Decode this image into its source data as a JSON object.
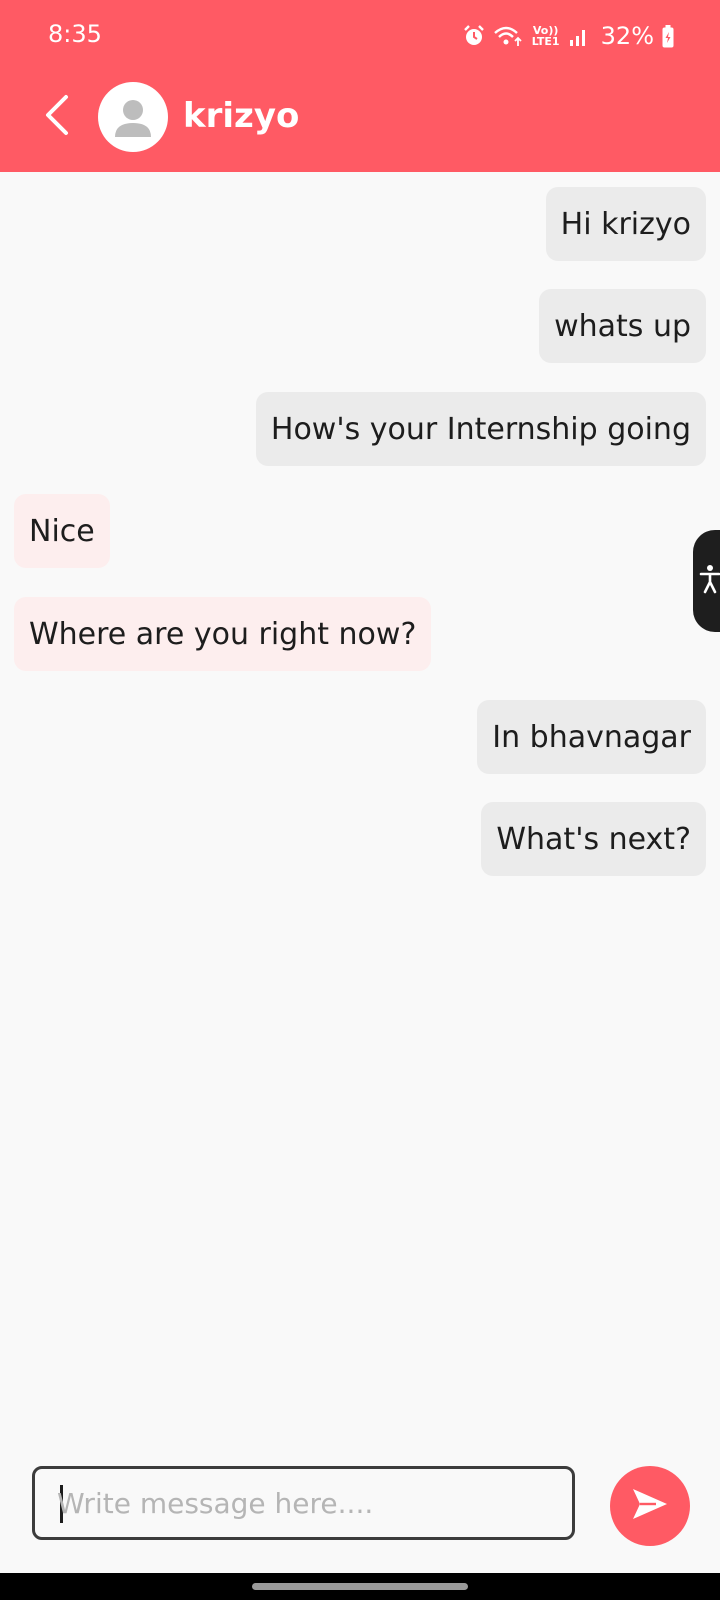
{
  "status_bar": {
    "time": "8:35",
    "network_label": "Vo)) LTE1",
    "battery": "32%",
    "icons": [
      "alarm-icon",
      "wifi-icon",
      "volte-icon",
      "signal-icon",
      "battery-charging-icon"
    ]
  },
  "header": {
    "contact_name": "krizyo",
    "back_icon": "chevron-left-icon",
    "avatar_icon": "person-icon"
  },
  "messages": [
    {
      "direction": "sent",
      "text": "Hi krizyo"
    },
    {
      "direction": "sent",
      "text": "whats up"
    },
    {
      "direction": "sent",
      "text": "How's your Internship going"
    },
    {
      "direction": "received",
      "text": "Nice"
    },
    {
      "direction": "received",
      "text": "Where are you right now?"
    },
    {
      "direction": "sent",
      "text": "In bhavnagar"
    },
    {
      "direction": "sent",
      "text": "What's next?"
    }
  ],
  "composer": {
    "placeholder": "Write message here....",
    "value": "",
    "send_icon": "send-icon"
  },
  "colors": {
    "accent": "#ff5a64",
    "sent_bubble": "#ebebeb",
    "received_bubble": "#fdeeee",
    "background": "#f9f9f9"
  }
}
